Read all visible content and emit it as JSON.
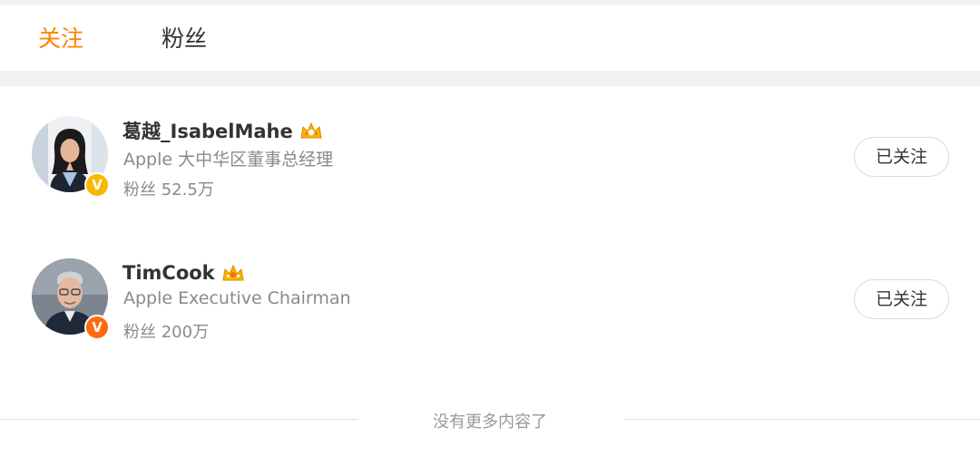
{
  "tabs": {
    "follow": "关注",
    "fans": "粉丝",
    "active": "follow"
  },
  "users": [
    {
      "name": "葛越_IsabelMahe",
      "bio": "Apple 大中华区董事总经理",
      "fans_label": "粉丝",
      "fans_count": "52.5万",
      "verified_badge": "V",
      "badge_color": "#f9b800",
      "avatar_icon": "woman-portrait",
      "follow_button": "已关注"
    },
    {
      "name": "TimCook",
      "bio": "Apple Executive Chairman",
      "fans_label": "粉丝",
      "fans_count": "200万",
      "verified_badge": "V",
      "badge_color": "#ff6a10",
      "avatar_icon": "man-portrait",
      "follow_button": "已关注"
    }
  ],
  "footer": {
    "text": "没有更多内容了"
  },
  "colors": {
    "accent": "#ff8200",
    "text": "#333333",
    "secondary_text": "#8a8a8a"
  }
}
